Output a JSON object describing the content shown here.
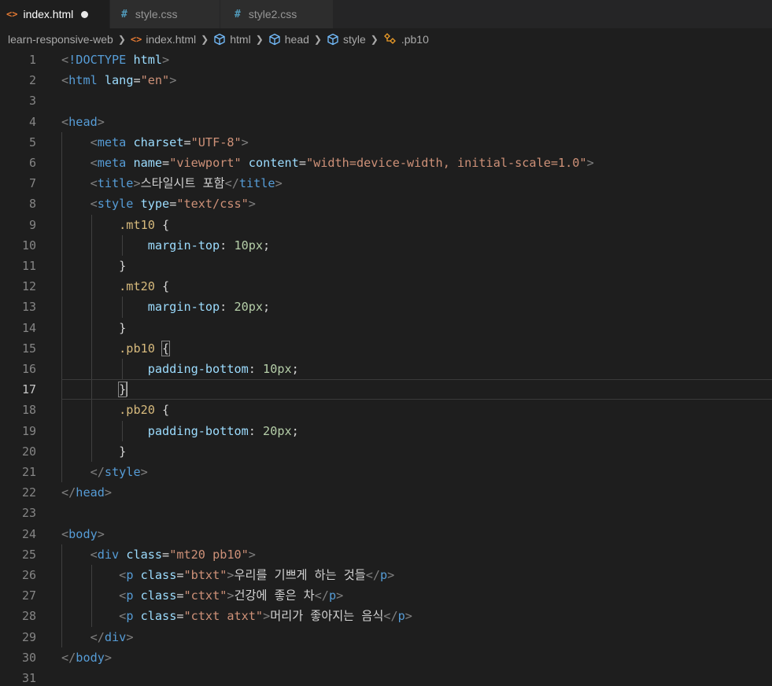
{
  "tabs": [
    {
      "label": "index.html",
      "icon": "html-file-icon",
      "active": true,
      "dirty": true
    },
    {
      "label": "style.css",
      "icon": "css-file-icon",
      "active": false,
      "dirty": false
    },
    {
      "label": "style2.css",
      "icon": "css-file-icon",
      "active": false,
      "dirty": false
    }
  ],
  "breadcrumb": [
    "learn-responsive-web",
    "index.html",
    "html",
    "head",
    "style",
    ".pb10"
  ],
  "current_line": 17,
  "lines": [
    [
      [
        "t-punc",
        "<"
      ],
      [
        "t-doctype",
        "!DOCTYPE"
      ],
      [
        "t-text",
        " "
      ],
      [
        "t-attr",
        "html"
      ],
      [
        "t-punc",
        ">"
      ]
    ],
    [
      [
        "t-punc",
        "<"
      ],
      [
        "t-tag",
        "html"
      ],
      [
        "t-text",
        " "
      ],
      [
        "t-attr",
        "lang"
      ],
      [
        "t-text",
        "="
      ],
      [
        "t-str",
        "\"en\""
      ],
      [
        "t-punc",
        ">"
      ]
    ],
    [],
    [
      [
        "t-punc",
        "<"
      ],
      [
        "t-tag",
        "head"
      ],
      [
        "t-punc",
        ">"
      ]
    ],
    [
      [
        "t-text",
        "    "
      ],
      [
        "t-punc",
        "<"
      ],
      [
        "t-tag",
        "meta"
      ],
      [
        "t-text",
        " "
      ],
      [
        "t-attr",
        "charset"
      ],
      [
        "t-text",
        "="
      ],
      [
        "t-str",
        "\"UTF-8\""
      ],
      [
        "t-punc",
        ">"
      ]
    ],
    [
      [
        "t-text",
        "    "
      ],
      [
        "t-punc",
        "<"
      ],
      [
        "t-tag",
        "meta"
      ],
      [
        "t-text",
        " "
      ],
      [
        "t-attr",
        "name"
      ],
      [
        "t-text",
        "="
      ],
      [
        "t-str",
        "\"viewport\""
      ],
      [
        "t-text",
        " "
      ],
      [
        "t-attr",
        "content"
      ],
      [
        "t-text",
        "="
      ],
      [
        "t-str",
        "\"width=device-width, initial-scale=1.0\""
      ],
      [
        "t-punc",
        ">"
      ]
    ],
    [
      [
        "t-text",
        "    "
      ],
      [
        "t-punc",
        "<"
      ],
      [
        "t-tag",
        "title"
      ],
      [
        "t-punc",
        ">"
      ],
      [
        "t-text",
        "스타일시트 포함"
      ],
      [
        "t-punc",
        "</"
      ],
      [
        "t-tag",
        "title"
      ],
      [
        "t-punc",
        ">"
      ]
    ],
    [
      [
        "t-text",
        "    "
      ],
      [
        "t-punc",
        "<"
      ],
      [
        "t-tag",
        "style"
      ],
      [
        "t-text",
        " "
      ],
      [
        "t-attr",
        "type"
      ],
      [
        "t-text",
        "="
      ],
      [
        "t-str",
        "\"text/css\""
      ],
      [
        "t-punc",
        ">"
      ]
    ],
    [
      [
        "t-text",
        "        "
      ],
      [
        "t-sel",
        ".mt10"
      ],
      [
        "t-text",
        " {"
      ]
    ],
    [
      [
        "t-text",
        "            "
      ],
      [
        "t-prop",
        "margin-top"
      ],
      [
        "t-text",
        ": "
      ],
      [
        "t-num",
        "10px"
      ],
      [
        "t-text",
        ";"
      ]
    ],
    [
      [
        "t-text",
        "        }"
      ]
    ],
    [
      [
        "t-text",
        "        "
      ],
      [
        "t-sel",
        ".mt20"
      ],
      [
        "t-text",
        " {"
      ]
    ],
    [
      [
        "t-text",
        "            "
      ],
      [
        "t-prop",
        "margin-top"
      ],
      [
        "t-text",
        ": "
      ],
      [
        "t-num",
        "20px"
      ],
      [
        "t-text",
        ";"
      ]
    ],
    [
      [
        "t-text",
        "        }"
      ]
    ],
    [
      [
        "t-text",
        "        "
      ],
      [
        "t-sel",
        ".pb10"
      ],
      [
        "t-text",
        " "
      ],
      [
        "t-brace-match",
        "{"
      ]
    ],
    [
      [
        "t-text",
        "            "
      ],
      [
        "t-prop",
        "padding-bottom"
      ],
      [
        "t-text",
        ": "
      ],
      [
        "t-num",
        "10px"
      ],
      [
        "t-text",
        ";"
      ]
    ],
    [
      [
        "t-text",
        "        "
      ],
      [
        "t-brace-match",
        "}"
      ],
      [
        "caret",
        ""
      ]
    ],
    [
      [
        "t-text",
        "        "
      ],
      [
        "t-sel",
        ".pb20"
      ],
      [
        "t-text",
        " {"
      ]
    ],
    [
      [
        "t-text",
        "            "
      ],
      [
        "t-prop",
        "padding-bottom"
      ],
      [
        "t-text",
        ": "
      ],
      [
        "t-num",
        "20px"
      ],
      [
        "t-text",
        ";"
      ]
    ],
    [
      [
        "t-text",
        "        }"
      ]
    ],
    [
      [
        "t-text",
        "    "
      ],
      [
        "t-punc",
        "</"
      ],
      [
        "t-tag",
        "style"
      ],
      [
        "t-punc",
        ">"
      ]
    ],
    [
      [
        "t-punc",
        "</"
      ],
      [
        "t-tag",
        "head"
      ],
      [
        "t-punc",
        ">"
      ]
    ],
    [],
    [
      [
        "t-punc",
        "<"
      ],
      [
        "t-tag",
        "body"
      ],
      [
        "t-punc",
        ">"
      ]
    ],
    [
      [
        "t-text",
        "    "
      ],
      [
        "t-punc",
        "<"
      ],
      [
        "t-tag",
        "div"
      ],
      [
        "t-text",
        " "
      ],
      [
        "t-attr",
        "class"
      ],
      [
        "t-text",
        "="
      ],
      [
        "t-str",
        "\"mt20 pb10\""
      ],
      [
        "t-punc",
        ">"
      ]
    ],
    [
      [
        "t-text",
        "        "
      ],
      [
        "t-punc",
        "<"
      ],
      [
        "t-tag",
        "p"
      ],
      [
        "t-text",
        " "
      ],
      [
        "t-attr",
        "class"
      ],
      [
        "t-text",
        "="
      ],
      [
        "t-str",
        "\"btxt\""
      ],
      [
        "t-punc",
        ">"
      ],
      [
        "t-text",
        "우리를 기쁘게 하는 것들"
      ],
      [
        "t-punc",
        "</"
      ],
      [
        "t-tag",
        "p"
      ],
      [
        "t-punc",
        ">"
      ]
    ],
    [
      [
        "t-text",
        "        "
      ],
      [
        "t-punc",
        "<"
      ],
      [
        "t-tag",
        "p"
      ],
      [
        "t-text",
        " "
      ],
      [
        "t-attr",
        "class"
      ],
      [
        "t-text",
        "="
      ],
      [
        "t-str",
        "\"ctxt\""
      ],
      [
        "t-punc",
        ">"
      ],
      [
        "t-text",
        "건강에 좋은 차"
      ],
      [
        "t-punc",
        "</"
      ],
      [
        "t-tag",
        "p"
      ],
      [
        "t-punc",
        ">"
      ]
    ],
    [
      [
        "t-text",
        "        "
      ],
      [
        "t-punc",
        "<"
      ],
      [
        "t-tag",
        "p"
      ],
      [
        "t-text",
        " "
      ],
      [
        "t-attr",
        "class"
      ],
      [
        "t-text",
        "="
      ],
      [
        "t-str",
        "\"ctxt atxt\""
      ],
      [
        "t-punc",
        ">"
      ],
      [
        "t-text",
        "머리가 좋아지는 음식"
      ],
      [
        "t-punc",
        "</"
      ],
      [
        "t-tag",
        "p"
      ],
      [
        "t-punc",
        ">"
      ]
    ],
    [
      [
        "t-text",
        "    "
      ],
      [
        "t-punc",
        "</"
      ],
      [
        "t-tag",
        "div"
      ],
      [
        "t-punc",
        ">"
      ]
    ],
    [
      [
        "t-punc",
        "</"
      ],
      [
        "t-tag",
        "body"
      ],
      [
        "t-punc",
        ">"
      ]
    ],
    []
  ],
  "colors": {
    "editor_bg": "#1e1e1e",
    "tabbar_bg": "#252526",
    "tag": "#569cd6",
    "attr": "#9cdcfe",
    "string": "#ce9178",
    "selector": "#d7ba7d",
    "number": "#b5cea8",
    "line_number": "#858585"
  }
}
